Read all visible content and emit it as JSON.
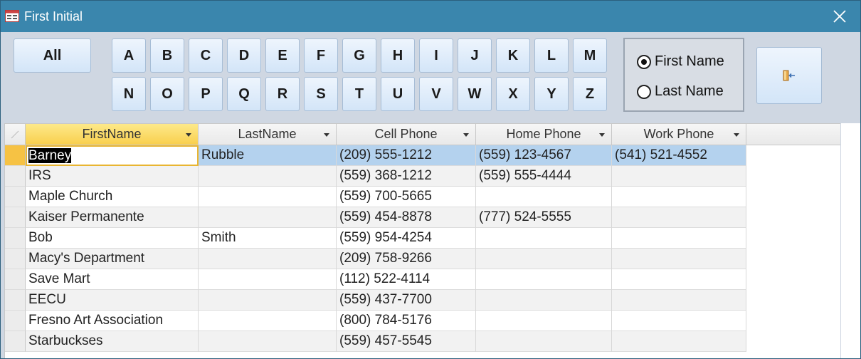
{
  "window": {
    "title": "First Initial"
  },
  "toolbar": {
    "all_label": "All",
    "letters_row1": [
      "A",
      "B",
      "C",
      "D",
      "E",
      "F",
      "G",
      "H",
      "I",
      "J",
      "K",
      "L",
      "M"
    ],
    "letters_row2": [
      "N",
      "O",
      "P",
      "Q",
      "R",
      "S",
      "T",
      "U",
      "V",
      "W",
      "X",
      "Y",
      "Z"
    ],
    "sort_options": [
      {
        "label": "First Name",
        "selected": true
      },
      {
        "label": "Last Name",
        "selected": false
      }
    ],
    "exit_icon": "exit-door-icon"
  },
  "grid": {
    "columns": [
      "FirstName",
      "LastName",
      "Cell Phone",
      "Home Phone",
      "Work Phone"
    ],
    "rows": [
      {
        "first": "Barney",
        "last": "Rubble",
        "cell": "(209) 555-1212",
        "home": "(559) 123-4567",
        "work": "(541) 521-4552"
      },
      {
        "first": "IRS",
        "last": "",
        "cell": "(559) 368-1212",
        "home": "(559) 555-4444",
        "work": ""
      },
      {
        "first": "Maple Church",
        "last": "",
        "cell": "(559) 700-5665",
        "home": "",
        "work": ""
      },
      {
        "first": "Kaiser Permanente",
        "last": "",
        "cell": "(559) 454-8878",
        "home": "(777) 524-5555",
        "work": ""
      },
      {
        "first": "Bob",
        "last": "Smith",
        "cell": "(559) 954-4254",
        "home": "",
        "work": ""
      },
      {
        "first": "Macy's Department",
        "last": "",
        "cell": "(209) 758-9266",
        "home": "",
        "work": ""
      },
      {
        "first": "Save Mart",
        "last": "",
        "cell": "(112) 522-4114",
        "home": "",
        "work": ""
      },
      {
        "first": "EECU",
        "last": "",
        "cell": "(559) 437-7700",
        "home": "",
        "work": ""
      },
      {
        "first": "Fresno Art Association",
        "last": "",
        "cell": "(800) 784-5176",
        "home": "",
        "work": ""
      },
      {
        "first": "Starbuckses",
        "last": "",
        "cell": "(559) 457-5545",
        "home": "",
        "work": ""
      }
    ]
  },
  "colors": {
    "titlebar": "#3a86ad",
    "selected_row": "#b4d2ee",
    "active_header": "#f9cf4d"
  }
}
